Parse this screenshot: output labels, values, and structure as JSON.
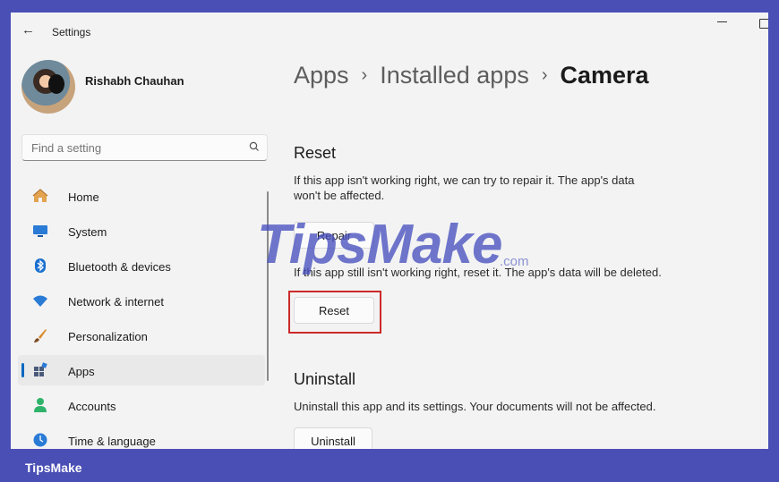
{
  "window": {
    "back_icon": "←",
    "title": "Settings"
  },
  "user": {
    "name": "Rishabh Chauhan"
  },
  "search": {
    "placeholder": "Find a setting",
    "icon": "search-icon"
  },
  "nav": {
    "items": [
      {
        "label": "Home",
        "icon": "home-icon",
        "active": false
      },
      {
        "label": "System",
        "icon": "monitor-icon",
        "active": false
      },
      {
        "label": "Bluetooth & devices",
        "icon": "bluetooth-icon",
        "active": false
      },
      {
        "label": "Network & internet",
        "icon": "wifi-icon",
        "active": false
      },
      {
        "label": "Personalization",
        "icon": "brush-icon",
        "active": false
      },
      {
        "label": "Apps",
        "icon": "apps-icon",
        "active": true
      },
      {
        "label": "Accounts",
        "icon": "person-icon",
        "active": false
      },
      {
        "label": "Time & language",
        "icon": "globe-clock-icon",
        "active": false
      }
    ]
  },
  "breadcrumb": {
    "items": [
      "Apps",
      "Installed apps"
    ],
    "separator": "›",
    "current": "Camera"
  },
  "reset_section": {
    "title": "Reset",
    "repair_desc_line1": "If this app isn't working right, we can try to repair it. The app's data",
    "repair_desc_line2": "won't be affected.",
    "repair_label": "Repair",
    "reset_desc": "If this app still isn't working right, reset it. The app's data will be deleted.",
    "reset_label": "Reset"
  },
  "uninstall_section": {
    "title": "Uninstall",
    "desc": "Uninstall this app and its settings. Your documents will not be affected.",
    "uninstall_label": "Uninstall"
  },
  "watermark": {
    "text": "TipsMake",
    "suffix": ".com"
  },
  "footer": {
    "brand": "TipsMake"
  },
  "colors": {
    "accent": "#0067c0",
    "frame": "#4a4fb5",
    "highlight": "#cc2929"
  }
}
